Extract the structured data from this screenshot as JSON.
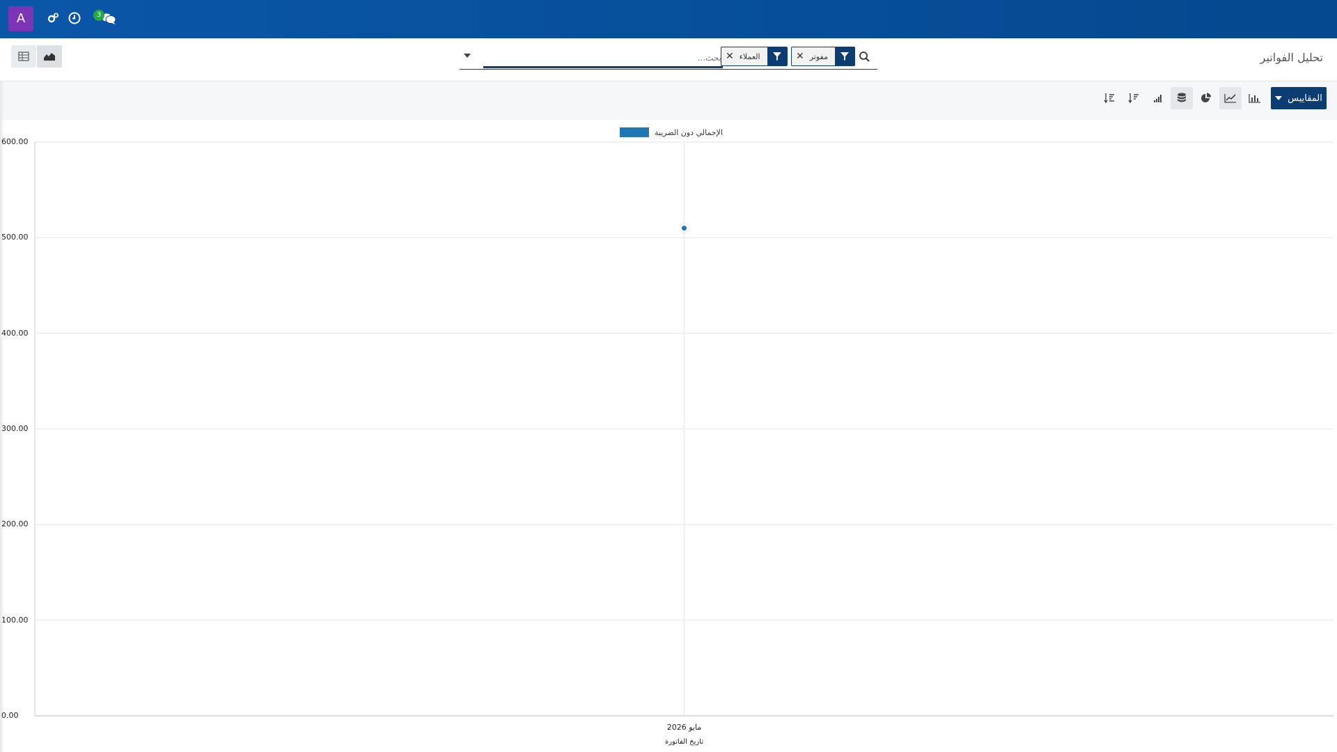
{
  "navbar": {
    "avatar_letter": "A",
    "chat_badge": "3",
    "icons": [
      "settings-cogs-icon",
      "clock-icon",
      "chat-bubbles-icon"
    ],
    "color": "#0a56a8"
  },
  "control_panel": {
    "title": "تحليل الفواتير",
    "search": {
      "placeholder": "بحث...",
      "facets": [
        {
          "label": "مفوتر",
          "icon": "filter-icon"
        },
        {
          "label": "العملاء",
          "icon": "filter-icon"
        }
      ]
    },
    "views": [
      "graph-view-icon",
      "pivot-view-icon"
    ]
  },
  "toolbar": {
    "measures_label": "المقاييس",
    "buttons": [
      {
        "name": "bar-chart",
        "icon": "bar-chart-icon"
      },
      {
        "name": "line-chart",
        "icon": "line-chart-icon",
        "active": true
      },
      {
        "name": "pie-chart",
        "icon": "pie-chart-icon"
      },
      {
        "name": "stacked",
        "icon": "database-stack-icon",
        "active": true
      },
      {
        "name": "ascending",
        "icon": "sort-ascending-icon"
      },
      {
        "name": "descending",
        "icon": "sort-descending-icon"
      },
      {
        "name": "sort-amount",
        "icon": "sort-amount-icon"
      }
    ],
    "accent": "#0b3d73"
  },
  "chart_data": {
    "type": "line",
    "categories": [
      "مايو 2026"
    ],
    "series": [
      {
        "name": "الإجمالي دون الضريبة",
        "values": [
          510
        ],
        "color": "#1f77b4"
      }
    ],
    "xlabel": "تاريخ الفاتورة",
    "ylabel": "",
    "ylim": [
      0,
      600
    ],
    "y_ticks": [
      "0.00",
      "100.00",
      "200.00",
      "300.00",
      "400.00",
      "500.00",
      "600.00"
    ],
    "grid": true,
    "legend": "top-center"
  }
}
